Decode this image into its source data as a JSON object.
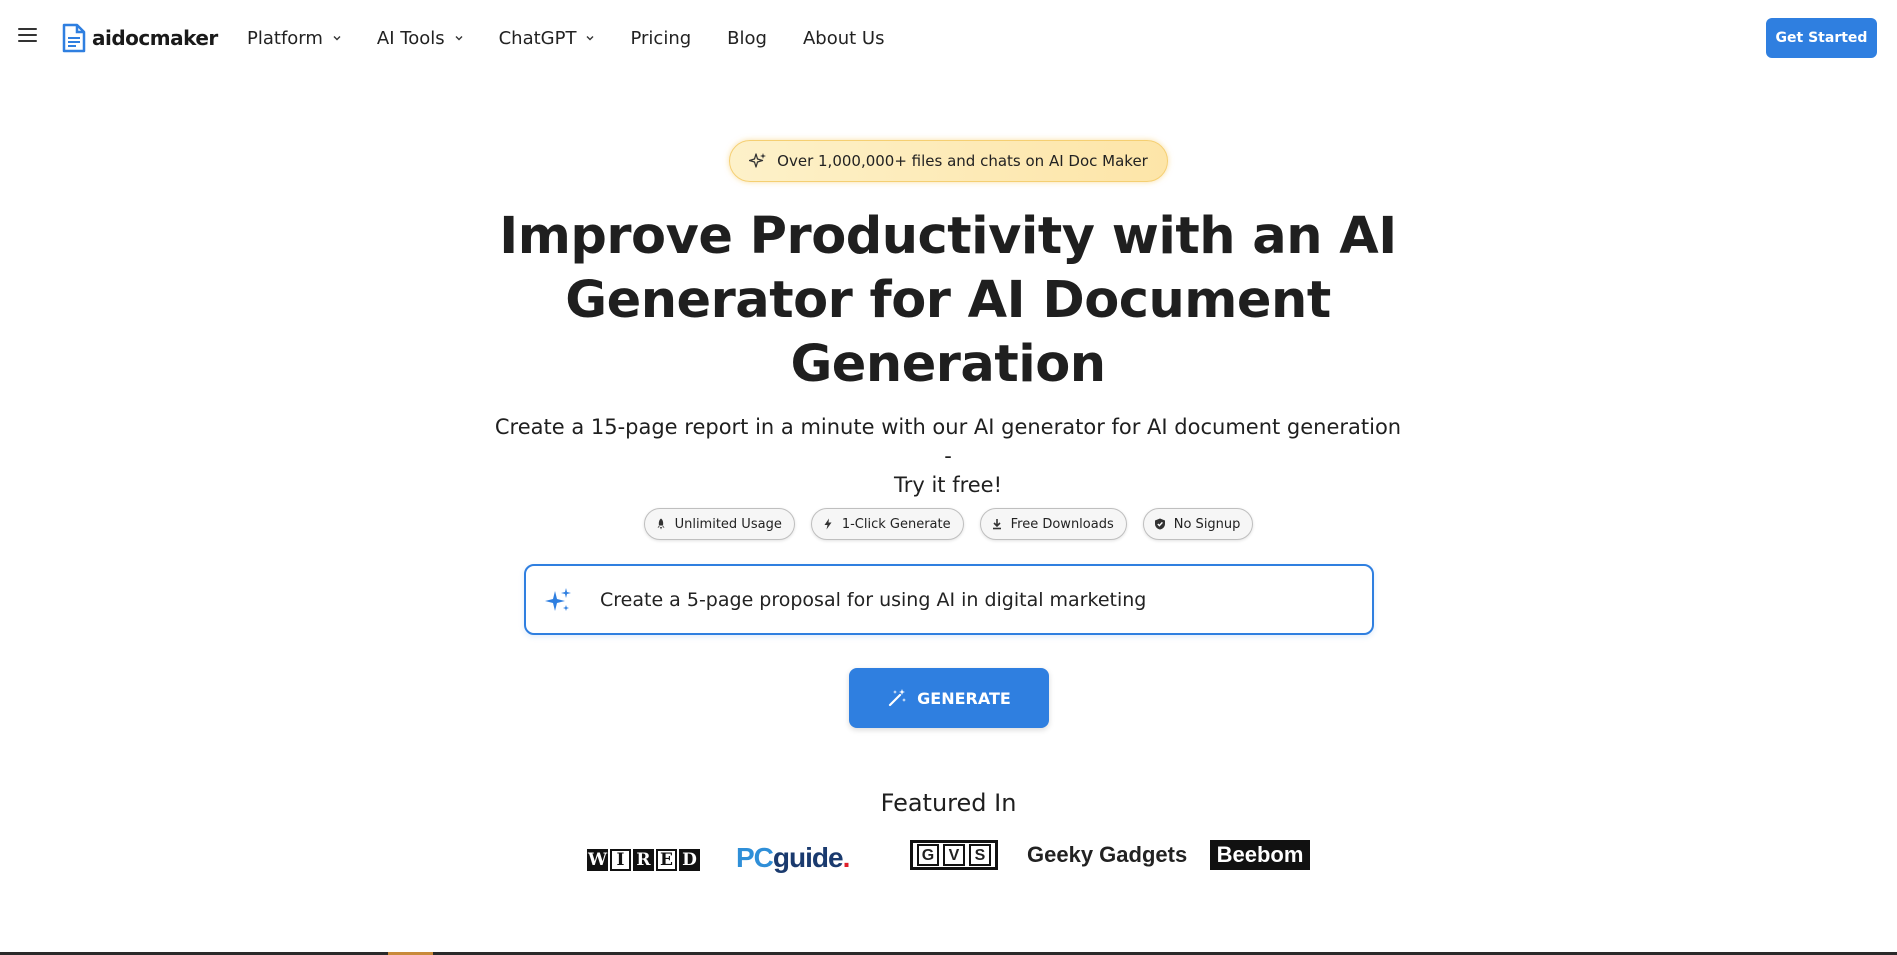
{
  "header": {
    "brand": "aidocmaker",
    "nav": [
      {
        "label": "Platform",
        "has_dropdown": true
      },
      {
        "label": "AI Tools",
        "has_dropdown": true
      },
      {
        "label": "ChatGPT",
        "has_dropdown": true
      },
      {
        "label": "Pricing",
        "has_dropdown": false
      },
      {
        "label": "Blog",
        "has_dropdown": false
      },
      {
        "label": "About Us",
        "has_dropdown": false
      }
    ],
    "cta": "Get Started"
  },
  "hero": {
    "badge": "Over 1,000,000+ files and chats on AI Doc Maker",
    "title_line1": "Improve Productivity with an AI",
    "title_line2": "Generator for AI Document",
    "title_line3": "Generation",
    "subtitle_line1": "Create a 15-page report in a minute with our AI generator for AI document generation -",
    "subtitle_line2": "Try it free!",
    "features": [
      {
        "label": "Unlimited Usage",
        "icon": "rocket-icon"
      },
      {
        "label": "1-Click Generate",
        "icon": "bolt-icon"
      },
      {
        "label": "Free Downloads",
        "icon": "download-icon"
      },
      {
        "label": "No Signup",
        "icon": "shield-check-icon"
      }
    ],
    "prompt_value": "Create a 5-page proposal for using AI in digital marketing",
    "generate_label": "GENERATE"
  },
  "featured": {
    "title": "Featured In",
    "wired": "WIRED",
    "pcguide_pc": "PC",
    "pcguide_rest": "guide",
    "pcguide_dot": ".",
    "gvs": [
      "G",
      "V",
      "S"
    ],
    "geeky": "Geeky Gadgets",
    "beebom": "Beebom"
  },
  "colors": {
    "accent": "#2f7fe0",
    "badge_bg": "#fde5a8"
  }
}
